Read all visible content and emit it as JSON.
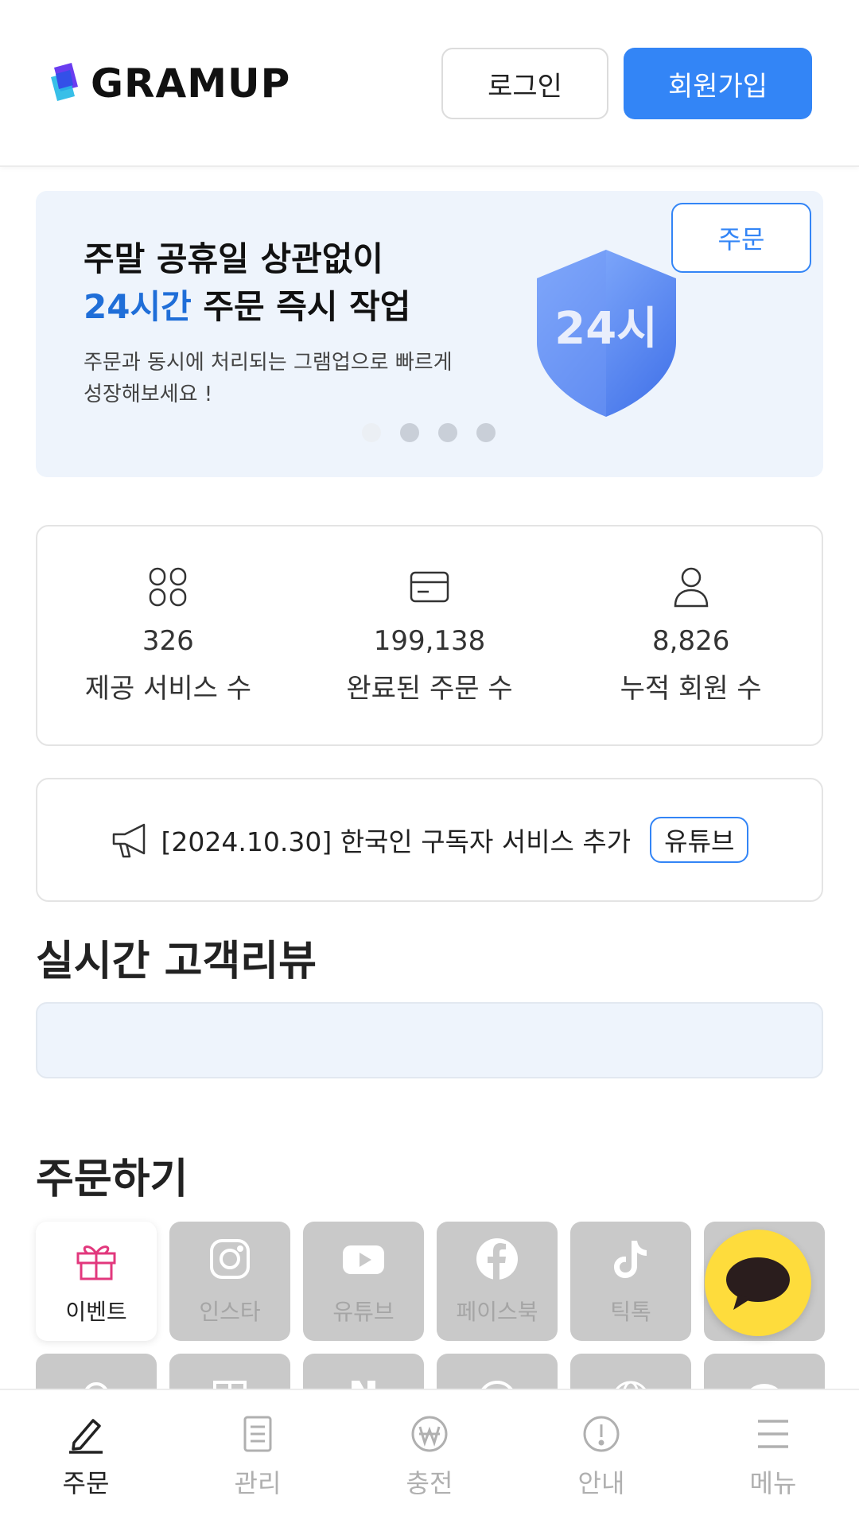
{
  "header": {
    "logo_text": "GRAMUP",
    "login_label": "로그인",
    "signup_label": "회원가입"
  },
  "banner": {
    "line1": "주말 공휴일 상관없이",
    "line2_accent": "24시간",
    "line2_rest": " 주문 즉시 작업",
    "subtitle": "주문과 동시에 처리되는 그램업으로 빠르게 성장해보세요 !",
    "order_label": "주문",
    "shield_text": "24시",
    "slide_count": 4,
    "active_slide": 1
  },
  "stats": [
    {
      "icon": "grid-icon",
      "value": "326",
      "label": "제공 서비스 수"
    },
    {
      "icon": "card-icon",
      "value": "199,138",
      "label": "완료된 주문 수"
    },
    {
      "icon": "user-icon",
      "value": "8,826",
      "label": "누적 회원 수"
    }
  ],
  "notice": {
    "icon": "megaphone-icon",
    "text": "[2024.10.30] 한국인 구독자 서비스 추가",
    "tag": "유튜브"
  },
  "reviews": {
    "title": "실시간 고객리뷰"
  },
  "order": {
    "title": "주문하기",
    "services": [
      {
        "icon": "gift-icon",
        "label": "이벤트",
        "active": true
      },
      {
        "icon": "instagram-icon",
        "label": "인스타",
        "active": false
      },
      {
        "icon": "youtube-icon",
        "label": "유튜브",
        "active": false
      },
      {
        "icon": "facebook-icon",
        "label": "페이스북",
        "active": false
      },
      {
        "icon": "tiktok-icon",
        "label": "틱톡",
        "active": false
      }
    ]
  },
  "bottom_nav": {
    "items": [
      {
        "icon": "pencil-icon",
        "label": "주문",
        "active": true
      },
      {
        "icon": "document-icon",
        "label": "관리",
        "active": false
      },
      {
        "icon": "won-icon",
        "label": "충전",
        "active": false
      },
      {
        "icon": "info-icon",
        "label": "안내",
        "active": false
      },
      {
        "icon": "menu-icon",
        "label": "메뉴",
        "active": false
      }
    ]
  },
  "colors": {
    "accent": "#3385f6",
    "banner_bg": "#eef4fc",
    "kakao": "#fedc3c",
    "tile_disabled": "#c9c9c9"
  }
}
